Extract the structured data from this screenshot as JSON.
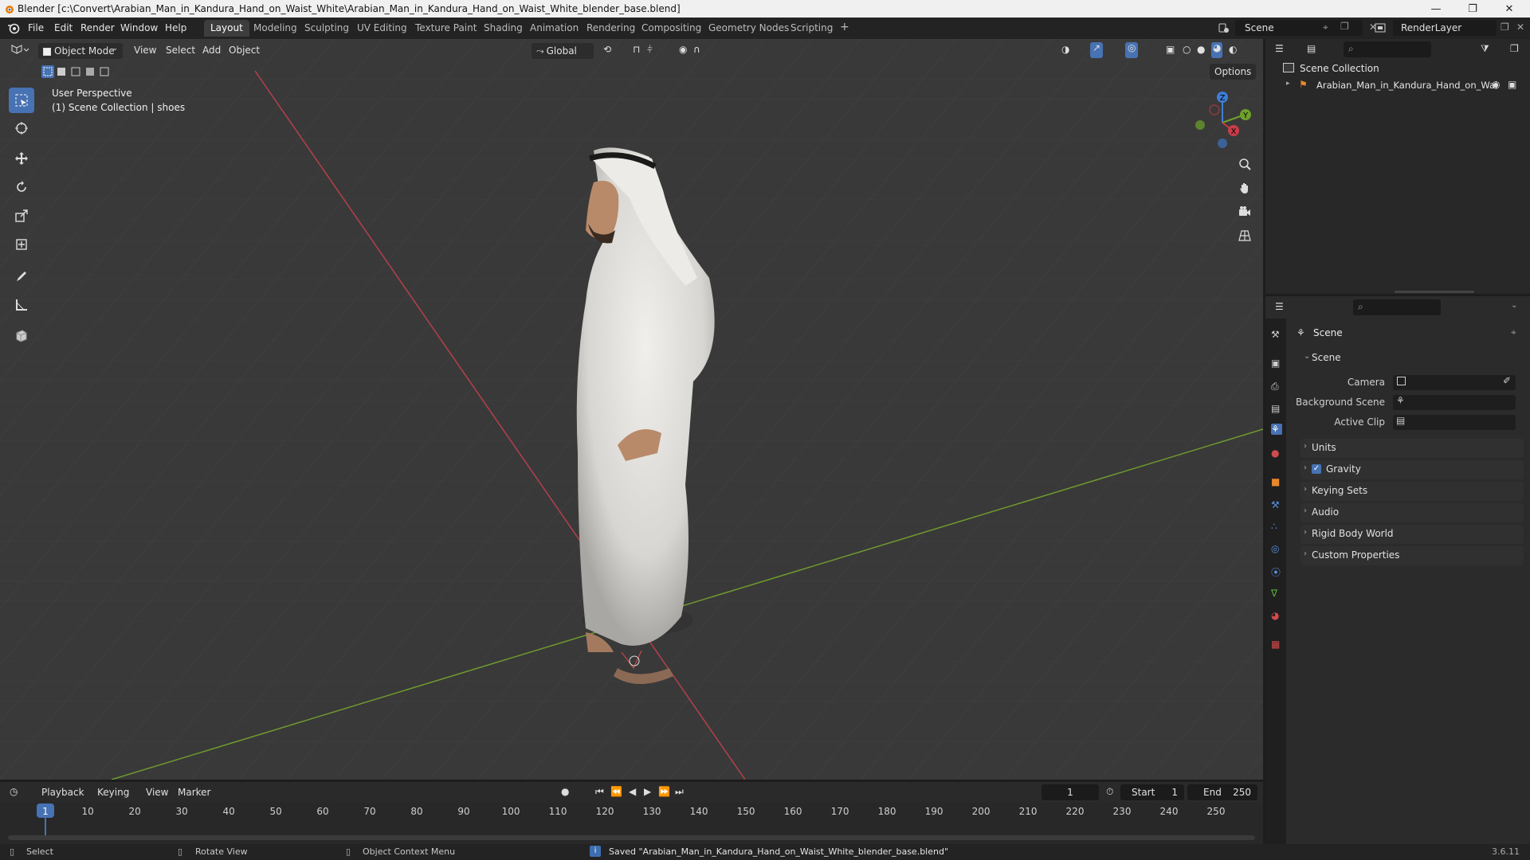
{
  "titlebar": {
    "title": "Blender [c:\\Convert\\Arabian_Man_in_Kandura_Hand_on_Waist_White\\Arabian_Man_in_Kandura_Hand_on_Waist_White_blender_base.blend]",
    "minimize": "—",
    "maximize": "❐",
    "close": "✕"
  },
  "menu": [
    "File",
    "Edit",
    "Render",
    "Window",
    "Help"
  ],
  "workspaces": [
    {
      "label": "Layout",
      "active": true
    },
    {
      "label": "Modeling"
    },
    {
      "label": "Sculpting"
    },
    {
      "label": "UV Editing"
    },
    {
      "label": "Texture Paint"
    },
    {
      "label": "Shading"
    },
    {
      "label": "Animation"
    },
    {
      "label": "Rendering"
    },
    {
      "label": "Compositing"
    },
    {
      "label": "Geometry Nodes"
    },
    {
      "label": "Scripting"
    }
  ],
  "add_workspace": "+",
  "scene_selector": "Scene",
  "render_layer": "RenderLayer",
  "viewport": {
    "mode": "Object Mode",
    "menus": [
      "View",
      "Select",
      "Add",
      "Object"
    ],
    "orientation": "Global",
    "options": "Options",
    "overlay_line1": "User Perspective",
    "overlay_line2": "(1) Scene Collection | shoes",
    "gizmo": {
      "z": "Z",
      "y": "Y",
      "x": "X"
    }
  },
  "outliner": {
    "root": "Scene Collection",
    "items": [
      "Arabian_Man_in_Kandura_Hand_on_Wai"
    ]
  },
  "properties": {
    "header": "Scene",
    "section": "Scene",
    "fields": [
      {
        "label": "Camera"
      },
      {
        "label": "Background Scene"
      },
      {
        "label": "Active Clip"
      }
    ],
    "panels": [
      "Units",
      "Gravity",
      "Keying Sets",
      "Audio",
      "Rigid Body World",
      "Custom Properties"
    ],
    "gravity_checked": true
  },
  "timeline": {
    "menus": [
      "Playback",
      "Keying",
      "View",
      "Marker"
    ],
    "current_frame": "1",
    "start_label": "Start",
    "start": "1",
    "end_label": "End",
    "end": "250",
    "ticks": [
      "1",
      "10",
      "20",
      "30",
      "40",
      "50",
      "60",
      "70",
      "80",
      "90",
      "100",
      "110",
      "120",
      "130",
      "140",
      "150",
      "160",
      "170",
      "180",
      "190",
      "200",
      "210",
      "220",
      "230",
      "240",
      "250"
    ]
  },
  "status": {
    "select": "Select",
    "rotate": "Rotate View",
    "context": "Object Context Menu",
    "message": "Saved \"Arabian_Man_in_Kandura_Hand_on_Waist_White_blender_base.blend\"",
    "version": "3.6.11"
  },
  "colors": {
    "accent": "#4772b3",
    "x_axis": "#c83c48",
    "y_axis": "#6ea22a",
    "z_axis": "#3e7ed6"
  }
}
